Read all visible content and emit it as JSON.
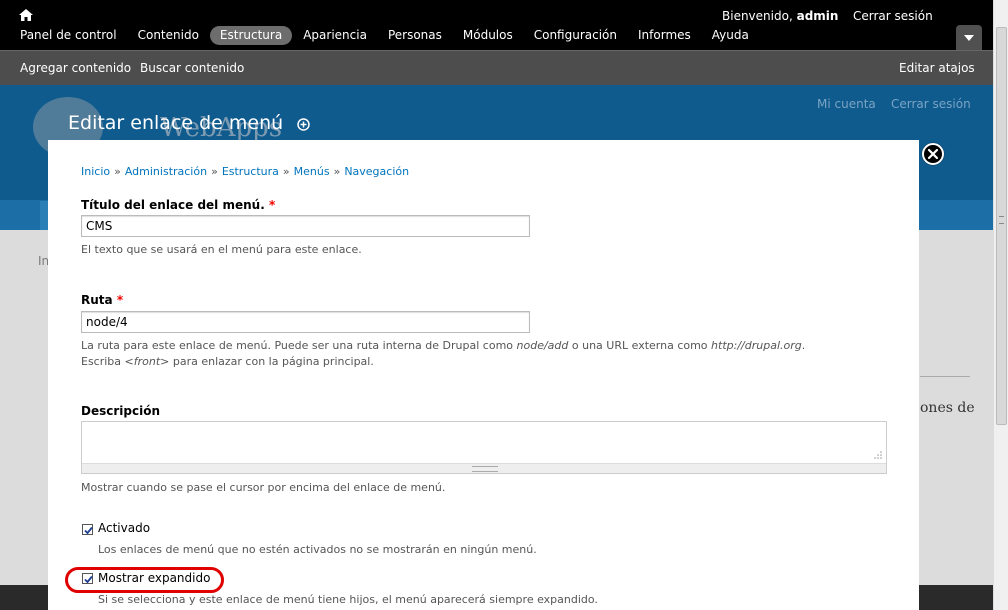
{
  "toolbar": {
    "home_icon": "home-icon",
    "welcome_prefix": "Bienvenido,",
    "username": "admin",
    "logout_label": "Cerrar sesión",
    "menu": [
      {
        "label": "Panel de control",
        "active": false
      },
      {
        "label": "Contenido",
        "active": false
      },
      {
        "label": "Estructura",
        "active": true
      },
      {
        "label": "Apariencia",
        "active": false
      },
      {
        "label": "Personas",
        "active": false
      },
      {
        "label": "Módulos",
        "active": false
      },
      {
        "label": "Configuración",
        "active": false
      },
      {
        "label": "Informes",
        "active": false
      },
      {
        "label": "Ayuda",
        "active": false
      }
    ],
    "drawer_icon": "chevron-down-icon"
  },
  "shortcuts": {
    "items": [
      {
        "label": "Agregar contenido"
      },
      {
        "label": "Buscar contenido"
      }
    ],
    "edit_label": "Editar atajos"
  },
  "background": {
    "site_name": "WebApps",
    "account_link": "Mi cuenta",
    "logout_link": "Cerrar sesión",
    "breadcrumb_fragment": "In",
    "snippet": "ones de"
  },
  "overlay": {
    "title": "Editar enlace de menú",
    "add_shortcut_icon": "add-shortcut-icon",
    "close_icon": "close-icon"
  },
  "breadcrumb": [
    {
      "label": "Inicio"
    },
    {
      "label": "Administración"
    },
    {
      "label": "Estructura"
    },
    {
      "label": "Menús"
    },
    {
      "label": "Navegación"
    }
  ],
  "breadcrumb_separator": "»",
  "form": {
    "title_field": {
      "label": "Título del enlace del menú.",
      "required_mark": "*",
      "value": "CMS",
      "help": "El texto que se usará en el menú para este enlace."
    },
    "path_field": {
      "label": "Ruta",
      "required_mark": "*",
      "value": "node/4",
      "help_line1_a": "La ruta para este enlace de menú. Puede ser una ruta interna de Drupal como ",
      "help_line1_em1": "node/add",
      "help_line1_b": " o una URL externa como ",
      "help_line1_em2": "http://drupal.org",
      "help_line1_c": ".",
      "help_line2_a": "Escriba ",
      "help_line2_em": "<front>",
      "help_line2_b": " para enlazar con la página principal."
    },
    "description_field": {
      "label": "Descripción",
      "value": "",
      "help": "Mostrar cuando se pase el cursor por encima del enlace de menú."
    },
    "enabled_field": {
      "label": "Activado",
      "checked": true,
      "help": "Los enlaces de menú que no estén activados no se mostrarán en ningún menú."
    },
    "expanded_field": {
      "label": "Mostrar expandido",
      "checked": true,
      "help": "Si se selecciona y este enlace de menú tiene hijos, el menú aparecerá siempre expandido."
    }
  },
  "colors": {
    "toolbar_bg": "#000000",
    "shortcut_bg": "#4d4d4d",
    "active_menu_bg": "#6d6d6d",
    "link": "#0074bd",
    "required": "#ee0000",
    "highlight": "#e00000"
  }
}
